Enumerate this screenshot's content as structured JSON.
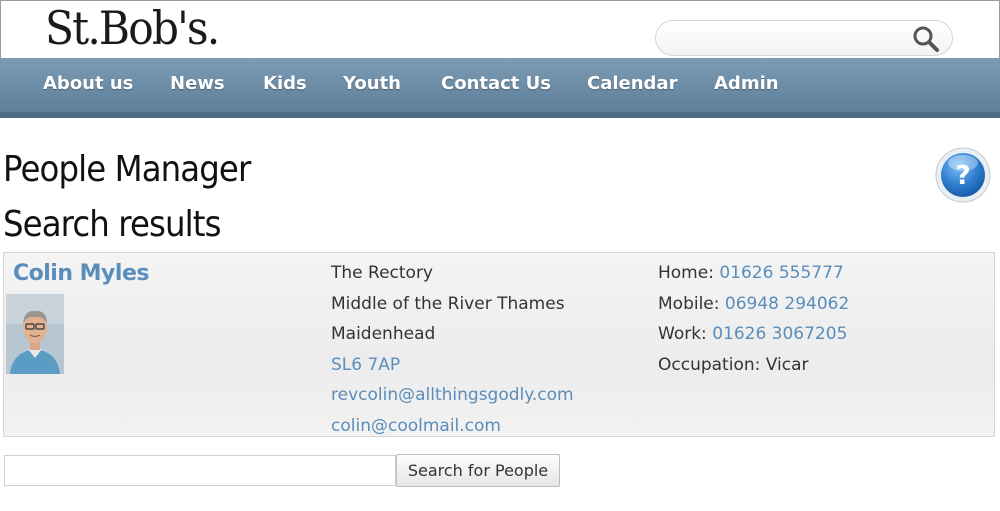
{
  "site": {
    "logo_text": "St.Bob's."
  },
  "header_search": {
    "placeholder": "",
    "icon": "magnifier-icon"
  },
  "nav": {
    "items": [
      "About us",
      "News",
      "Kids",
      "Youth",
      "Contact Us",
      "Calendar",
      "Admin"
    ]
  },
  "page": {
    "title": "People Manager",
    "subtitle": "Search results",
    "help_icon": "question-mark-icon"
  },
  "result": {
    "name": "Colin Myles",
    "address": [
      "The Rectory",
      "Middle of the River Thames",
      "Maidenhead"
    ],
    "postcode": "SL6 7AP",
    "emails": [
      "revcolin@allthingsgodly.com",
      "colin@coolmail.com"
    ],
    "contacts": {
      "home_label": "Home:",
      "home_value": "01626 555777",
      "mobile_label": "Mobile:",
      "mobile_value": "06948 294062",
      "work_label": "Work:",
      "work_value": "01626 3067205",
      "occupation_label": "Occupation:",
      "occupation_value": "Vicar"
    }
  },
  "people_search": {
    "value": "",
    "button_label": "Search for People"
  },
  "colors": {
    "nav_bg": "#6a8aa6",
    "link": "#5b8dbb",
    "help_blue": "#2f7fd0"
  }
}
